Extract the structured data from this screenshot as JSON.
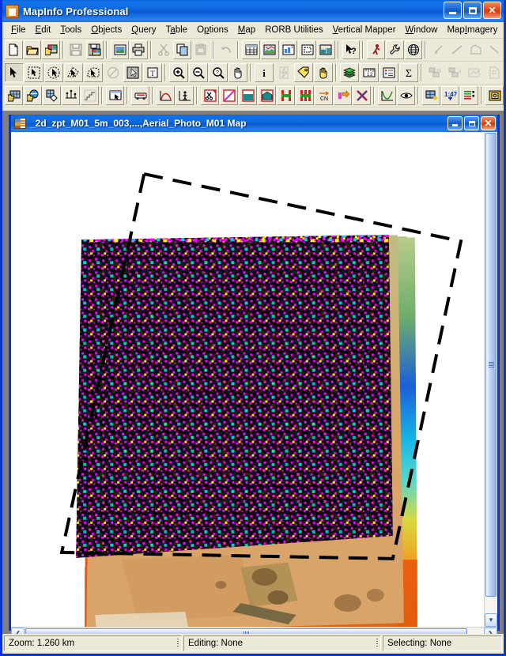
{
  "app": {
    "title": "MapInfo Professional",
    "icon": "mapinfo-app-icon",
    "window_buttons": [
      {
        "name": "minimize",
        "glyph": "_"
      },
      {
        "name": "maximize",
        "glyph": "□"
      },
      {
        "name": "close",
        "glyph": "✕"
      }
    ]
  },
  "menubar": {
    "items": [
      {
        "label": "File",
        "accel": "F"
      },
      {
        "label": "Edit",
        "accel": "E"
      },
      {
        "label": "Tools",
        "accel": "T"
      },
      {
        "label": "Objects",
        "accel": "O"
      },
      {
        "label": "Query",
        "accel": "Q"
      },
      {
        "label": "Table",
        "accel": "a"
      },
      {
        "label": "Options",
        "accel": "p"
      },
      {
        "label": "Map",
        "accel": "M"
      },
      {
        "label": "RORB Utilities",
        "accel": ""
      },
      {
        "label": "Vertical Mapper",
        "accel": "V"
      },
      {
        "label": "Window",
        "accel": "W"
      },
      {
        "label": "MapImagery",
        "accel": "I"
      },
      {
        "label": "Help",
        "accel": "H"
      }
    ]
  },
  "toolbars": {
    "standard": [
      {
        "name": "new-table-button",
        "icon": "new-document-icon",
        "enabled": true
      },
      {
        "name": "open-table-button",
        "icon": "open-folder-icon",
        "enabled": true
      },
      {
        "name": "open-workspace-button",
        "icon": "open-workspace-icon",
        "enabled": true
      },
      {
        "name": "save-table-button",
        "icon": "floppy-save-icon",
        "enabled": false
      },
      {
        "name": "save-workspace-button",
        "icon": "save-workspace-icon",
        "enabled": true
      },
      {
        "name": "print-preview-button",
        "icon": "print-preview-icon",
        "enabled": true
      },
      {
        "name": "print-button",
        "icon": "printer-icon",
        "enabled": true
      },
      {
        "name": "cut-button",
        "icon": "scissors-icon",
        "enabled": false
      },
      {
        "name": "copy-button",
        "icon": "copy-pages-icon",
        "enabled": true
      },
      {
        "name": "paste-button",
        "icon": "clipboard-paste-icon",
        "enabled": false
      },
      {
        "name": "undo-button",
        "icon": "undo-arrow-icon",
        "enabled": false
      },
      {
        "name": "new-browser-button",
        "icon": "browser-grid-icon",
        "enabled": true
      },
      {
        "name": "new-mapper-button",
        "icon": "globe-map-icon",
        "enabled": true
      },
      {
        "name": "new-grapher-button",
        "icon": "graph-window-icon",
        "enabled": true
      },
      {
        "name": "new-layout-button",
        "icon": "layout-window-icon",
        "enabled": true
      },
      {
        "name": "new-redistrict-button",
        "icon": "redistrict-icon",
        "enabled": true
      },
      {
        "name": "help-pointer-button",
        "icon": "help-arrow-question-icon",
        "enabled": true
      },
      {
        "name": "run-mapbasic-button",
        "icon": "running-man-icon",
        "enabled": true
      },
      {
        "name": "show-mapbasic-window-button",
        "icon": "wrench-icon",
        "enabled": true
      },
      {
        "name": "web-services-button",
        "icon": "globe-grid-icon",
        "enabled": true
      },
      {
        "name": "dwg-import-button",
        "icon": "dwg-pick-icon",
        "enabled": false
      },
      {
        "name": "line-style-button",
        "icon": "line-diagonal-icon",
        "enabled": false
      },
      {
        "name": "region-style-button",
        "icon": "polygon-region-icon",
        "enabled": false
      },
      {
        "name": "more-styles-button",
        "icon": "style-arrow-icon",
        "enabled": false
      }
    ],
    "main": [
      {
        "name": "select-tool",
        "icon": "arrow-pointer-icon",
        "enabled": true,
        "active": true
      },
      {
        "name": "marquee-select-tool",
        "icon": "marquee-select-icon",
        "enabled": true
      },
      {
        "name": "radius-select-tool",
        "icon": "radius-select-icon",
        "enabled": true
      },
      {
        "name": "polygon-select-tool",
        "icon": "polygon-select-icon",
        "enabled": true
      },
      {
        "name": "boundary-select-tool",
        "icon": "boundary-select-icon",
        "enabled": true
      },
      {
        "name": "unselect-all-tool",
        "icon": "unselect-all-icon",
        "enabled": false
      },
      {
        "name": "graph-select-tool",
        "icon": "graph-select-icon",
        "enabled": true
      },
      {
        "name": "expand-text-tool",
        "icon": "text-box-icon",
        "enabled": true
      },
      {
        "name": "zoom-in-tool",
        "icon": "zoom-in-magnifier-icon",
        "enabled": true
      },
      {
        "name": "zoom-out-tool",
        "icon": "zoom-out-magnifier-icon",
        "enabled": true
      },
      {
        "name": "change-view-tool",
        "icon": "zoom-question-icon",
        "enabled": true
      },
      {
        "name": "grabber-tool",
        "icon": "hand-pan-icon",
        "enabled": true
      },
      {
        "name": "info-tool",
        "icon": "info-i-icon",
        "enabled": true
      },
      {
        "name": "hotlink-tool",
        "icon": "lightning-hotlink-icon",
        "enabled": false
      },
      {
        "name": "label-tool",
        "icon": "label-tag-icon",
        "enabled": true
      },
      {
        "name": "drag-map-window-tool",
        "icon": "drag-map-hand-icon",
        "enabled": true
      },
      {
        "name": "layer-control-button",
        "icon": "layered-stack-icon",
        "enabled": true
      },
      {
        "name": "ruler-tool",
        "icon": "ruler-measure-icon",
        "enabled": true
      },
      {
        "name": "legend-button",
        "icon": "legend-list-icon",
        "enabled": true
      },
      {
        "name": "statistics-button",
        "icon": "sigma-statistics-icon",
        "enabled": true
      },
      {
        "name": "set-target-button",
        "icon": "set-target-icon",
        "enabled": false
      },
      {
        "name": "clear-target-button",
        "icon": "clear-target-icon",
        "enabled": false
      },
      {
        "name": "set-clip-region-button",
        "icon": "clip-region-icon",
        "enabled": false
      },
      {
        "name": "toggle-clip-button",
        "icon": "toggle-clip-icon",
        "enabled": false
      }
    ],
    "vertical_mapper": [
      {
        "name": "grid-create-button",
        "icon": "grid-create-icon",
        "enabled": true
      },
      {
        "name": "grid-open-button",
        "icon": "grid-globe-icon",
        "enabled": true
      },
      {
        "name": "grid-export-button",
        "icon": "grid-export-icon",
        "enabled": true
      },
      {
        "name": "triangulation-button",
        "icon": "triangulation-icon",
        "enabled": true
      },
      {
        "name": "grid-stats-button",
        "icon": "grid-cells-icon",
        "enabled": true
      },
      {
        "name": "grid-info-tool",
        "icon": "grid-info-pointer-icon",
        "enabled": true
      },
      {
        "name": "rorb-run-button",
        "icon": "rorb-vehicle-icon",
        "enabled": true
      },
      {
        "name": "profile-button",
        "icon": "profile-curve-icon",
        "enabled": true
      },
      {
        "name": "viewshed-button",
        "icon": "viewshed-person-icon",
        "enabled": true
      },
      {
        "name": "cut-region-button",
        "icon": "cut-region-scissors-icon",
        "enabled": true
      },
      {
        "name": "slope-button",
        "icon": "slope-diagonal-icon",
        "enabled": true
      },
      {
        "name": "fill-region-button",
        "icon": "fill-region-icon",
        "enabled": true
      },
      {
        "name": "catchment-button",
        "icon": "catchment-house-icon",
        "enabled": true
      },
      {
        "name": "cross-section-button",
        "icon": "cross-section-icon",
        "enabled": true
      },
      {
        "name": "cn-grid-button",
        "icon": "cn-grid-icon",
        "enabled": true
      },
      {
        "name": "cn-label-button",
        "icon": "cn-label-icon",
        "enabled": true
      },
      {
        "name": "reach-arrow-button",
        "icon": "reach-arrow-icon",
        "enabled": true
      },
      {
        "name": "delete-reach-button",
        "icon": "delete-red-x-icon",
        "enabled": true
      },
      {
        "name": "hydrograph-button",
        "icon": "hydrograph-curve-icon",
        "enabled": true
      },
      {
        "name": "visibility-button",
        "icon": "eye-visibility-icon",
        "enabled": true
      },
      {
        "name": "grid-append-button",
        "icon": "grid-append-plus-icon",
        "enabled": true
      },
      {
        "name": "grid-value-button",
        "icon": "grid-value-147-icon",
        "enabled": true
      },
      {
        "name": "color-legend-button",
        "icon": "color-legend-bars-icon",
        "enabled": true
      },
      {
        "name": "grid-properties-button",
        "icon": "grid-properties-icon",
        "enabled": true
      }
    ]
  },
  "child_window": {
    "title": "_2d_zpt_M01_5m_003,...,Aerial_Photo_M01 Map",
    "icon": "map-window-icon",
    "buttons": [
      {
        "name": "minimize",
        "glyph": "_"
      },
      {
        "name": "maximize",
        "glyph": "□"
      },
      {
        "name": "close",
        "glyph": "✕"
      }
    ],
    "scrollbars": {
      "vertical": {
        "down_arrow": "▾",
        "thumb_grip": "grip-icon"
      },
      "horizontal": {
        "left_arrow": "❮",
        "right_arrow": "❯",
        "thumb_grip": "grip-icon"
      }
    }
  },
  "map": {
    "background": "#ffffff",
    "layers": [
      {
        "name": "dashed-boundary-rectangle",
        "style": "dashed black rotated rectangle",
        "color": "#000000"
      },
      {
        "name": "aerial-photo-raster",
        "description": "Aerial_Photo_M01 tan/olive aerial imagery"
      },
      {
        "name": "elevation-grid-raster",
        "description": "_2d_zpt_M01_5m_003 rainbow DEM grid"
      },
      {
        "name": "point-symbol-layer",
        "description": "dense scatter of point symbols on black fill"
      }
    ],
    "symbol_colors": {
      "magenta": "#ff00ff",
      "cyan": "#00d8d8",
      "yellow": "#ffff00",
      "green": "#00a000",
      "fill": "#000000"
    },
    "grid_ramp": [
      "#0033cc",
      "#00a8e8",
      "#00d4a0",
      "#7fd43a",
      "#e8e820",
      "#ffa000",
      "#ff4000"
    ]
  },
  "statusbar": {
    "zoom": "Zoom: 1.260 km",
    "editing": "Editing: None",
    "selecting": "Selecting: None"
  }
}
